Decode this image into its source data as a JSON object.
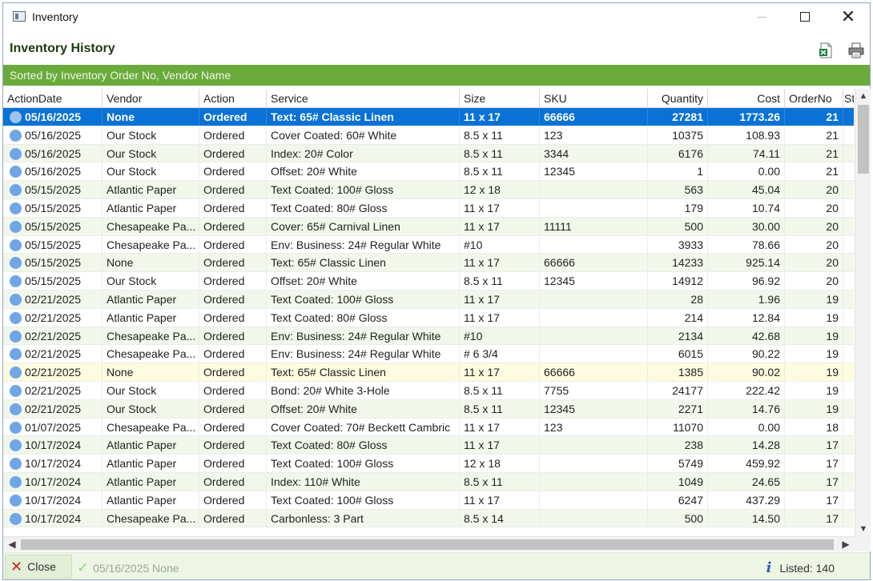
{
  "window": {
    "title": "Inventory"
  },
  "header": {
    "title": "Inventory History",
    "sort_text": "Sorted by Inventory Order No, Vendor Name"
  },
  "grid": {
    "columns": [
      "ActionDate",
      "Vendor",
      "Action",
      "Service",
      "Size",
      "SKU",
      "Quantity",
      "Cost",
      "OrderNo",
      "St"
    ],
    "rows": [
      [
        "05/16/2025",
        "None",
        "Ordered",
        "Text: 65# Classic Linen",
        "11 x 17",
        "66666",
        "27281",
        "1773.26",
        "21"
      ],
      [
        "05/16/2025",
        "Our Stock",
        "Ordered",
        "Cover Coated: 60# White",
        "8.5 x 11",
        "123",
        "10375",
        "108.93",
        "21"
      ],
      [
        "05/16/2025",
        "Our Stock",
        "Ordered",
        "Index: 20# Color",
        "8.5 x 11",
        "3344",
        "6176",
        "74.11",
        "21"
      ],
      [
        "05/16/2025",
        "Our Stock",
        "Ordered",
        "Offset: 20# White",
        "8.5 x 11",
        "12345",
        "1",
        "0.00",
        "21"
      ],
      [
        "05/15/2025",
        "Atlantic Paper",
        "Ordered",
        "Text Coated: 100# Gloss",
        "12 x 18",
        "",
        "563",
        "45.04",
        "20"
      ],
      [
        "05/15/2025",
        "Atlantic Paper",
        "Ordered",
        "Text Coated: 80# Gloss",
        "11 x 17",
        "",
        "179",
        "10.74",
        "20"
      ],
      [
        "05/15/2025",
        "Chesapeake Pa...",
        "Ordered",
        "Cover: 65# Carnival Linen",
        "11 x 17",
        "11111",
        "500",
        "30.00",
        "20"
      ],
      [
        "05/15/2025",
        "Chesapeake Pa...",
        "Ordered",
        "Env: Business: 24# Regular White",
        "#10",
        "",
        "3933",
        "78.66",
        "20"
      ],
      [
        "05/15/2025",
        "None",
        "Ordered",
        "Text: 65# Classic Linen",
        "11 x 17",
        "66666",
        "14233",
        "925.14",
        "20"
      ],
      [
        "05/15/2025",
        "Our Stock",
        "Ordered",
        "Offset: 20# White",
        "8.5 x 11",
        "12345",
        "14912",
        "96.92",
        "20"
      ],
      [
        "02/21/2025",
        "Atlantic Paper",
        "Ordered",
        "Text Coated: 100# Gloss",
        "11 x 17",
        "",
        "28",
        "1.96",
        "19"
      ],
      [
        "02/21/2025",
        "Atlantic Paper",
        "Ordered",
        "Text Coated: 80# Gloss",
        "11 x 17",
        "",
        "214",
        "12.84",
        "19"
      ],
      [
        "02/21/2025",
        "Chesapeake Pa...",
        "Ordered",
        "Env: Business: 24# Regular White",
        "#10",
        "",
        "2134",
        "42.68",
        "19"
      ],
      [
        "02/21/2025",
        "Chesapeake Pa...",
        "Ordered",
        "Env: Business: 24# Regular White",
        "# 6 3/4",
        "",
        "6015",
        "90.22",
        "19"
      ],
      [
        "02/21/2025",
        "None",
        "Ordered",
        "Text: 65# Classic Linen",
        "11 x 17",
        "66666",
        "1385",
        "90.02",
        "19"
      ],
      [
        "02/21/2025",
        "Our Stock",
        "Ordered",
        "Bond: 20# White 3-Hole",
        "8.5 x 11",
        "7755",
        "24177",
        "222.42",
        "19"
      ],
      [
        "02/21/2025",
        "Our Stock",
        "Ordered",
        "Offset: 20# White",
        "8.5 x 11",
        "12345",
        "2271",
        "14.76",
        "19"
      ],
      [
        "01/07/2025",
        "Chesapeake Pa...",
        "Ordered",
        "Cover Coated: 70# Beckett Cambric",
        "11 x 17",
        "123",
        "11070",
        "0.00",
        "18"
      ],
      [
        "10/17/2024",
        "Atlantic Paper",
        "Ordered",
        "Text Coated: 80# Gloss",
        "11 x 17",
        "",
        "238",
        "14.28",
        "17"
      ],
      [
        "10/17/2024",
        "Atlantic Paper",
        "Ordered",
        "Text Coated: 100# Gloss",
        "12 x 18",
        "",
        "5749",
        "459.92",
        "17"
      ],
      [
        "10/17/2024",
        "Atlantic Paper",
        "Ordered",
        "Index: 110# White",
        "8.5 x 11",
        "",
        "1049",
        "24.65",
        "17"
      ],
      [
        "10/17/2024",
        "Atlantic Paper",
        "Ordered",
        "Text Coated: 100# Gloss",
        "11 x 17",
        "",
        "6247",
        "437.29",
        "17"
      ],
      [
        "10/17/2024",
        "Chesapeake Pa...",
        "Ordered",
        "Carbonless: 3 Part",
        "8.5 x 14",
        "",
        "500",
        "14.50",
        "17"
      ]
    ]
  },
  "footer": {
    "close_label": "Close",
    "selected_status": "05/16/2025 None",
    "listed": "Listed: 140"
  },
  "icons": {
    "excel": "excel-export-icon",
    "print": "print-icon",
    "info": "info-icon"
  }
}
